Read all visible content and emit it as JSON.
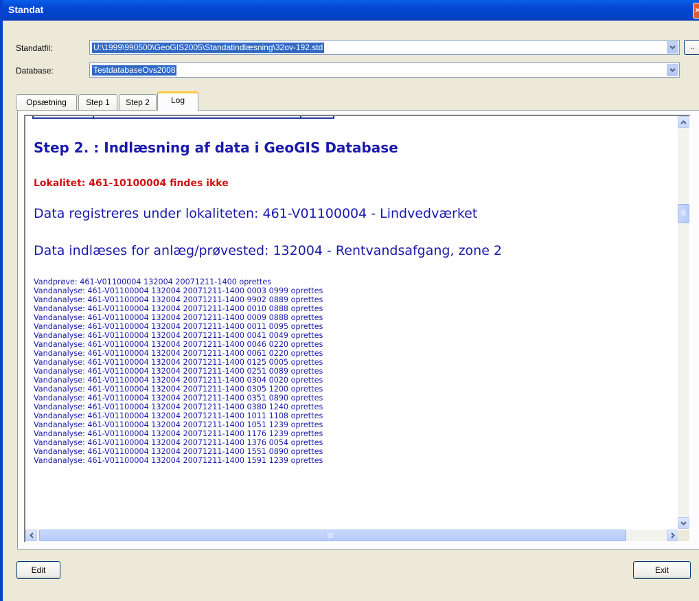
{
  "window": {
    "title": "Standat",
    "close_glyph": "✕"
  },
  "form": {
    "standatfil_label": "Standatfil:",
    "standatfil_value": "U:\\1999\\990500\\GeoGIS2005\\Standatindlæsning\\32ov-192.std",
    "browse_label": "..",
    "database_label": "Database:",
    "database_value": "TestdatabaseOvs2008"
  },
  "tabs": [
    {
      "label": "Opsætning",
      "active": false
    },
    {
      "label": "Step 1",
      "active": false
    },
    {
      "label": "Step 2",
      "active": false
    },
    {
      "label": "Log",
      "active": true
    }
  ],
  "log": {
    "heading": "Step 2. : Indlæsning af data i GeoGIS Database",
    "warning": "Lokalitet: 461-10100004 findes ikke",
    "locality_line": "Data registreres under lokaliteten: 461-V01100004 - Lindvedværket",
    "site_line": "Data indlæses for anlæg/prøvested: 132004 - Rentvandsafgang, zone 2",
    "entries": [
      "Vandprøve: 461-V01100004 132004 20071211-1400 oprettes",
      "Vandanalyse: 461-V01100004 132004 20071211-1400 0003 0999 oprettes",
      "Vandanalyse: 461-V01100004 132004 20071211-1400 9902 0889 oprettes",
      "Vandanalyse: 461-V01100004 132004 20071211-1400 0010 0888 oprettes",
      "Vandanalyse: 461-V01100004 132004 20071211-1400 0009 0888 oprettes",
      "Vandanalyse: 461-V01100004 132004 20071211-1400 0011 0095 oprettes",
      "Vandanalyse: 461-V01100004 132004 20071211-1400 0041 0049 oprettes",
      "Vandanalyse: 461-V01100004 132004 20071211-1400 0046 0220 oprettes",
      "Vandanalyse: 461-V01100004 132004 20071211-1400 0061 0220 oprettes",
      "Vandanalyse: 461-V01100004 132004 20071211-1400 0125 0005 oprettes",
      "Vandanalyse: 461-V01100004 132004 20071211-1400 0251 0089 oprettes",
      "Vandanalyse: 461-V01100004 132004 20071211-1400 0304 0020 oprettes",
      "Vandanalyse: 461-V01100004 132004 20071211-1400 0305 1200 oprettes",
      "Vandanalyse: 461-V01100004 132004 20071211-1400 0351 0890 oprettes",
      "Vandanalyse: 461-V01100004 132004 20071211-1400 0380 1240 oprettes",
      "Vandanalyse: 461-V01100004 132004 20071211-1400 1011 1108 oprettes",
      "Vandanalyse: 461-V01100004 132004 20071211-1400 1051 1239 oprettes",
      "Vandanalyse: 461-V01100004 132004 20071211-1400 1176 1239 oprettes",
      "Vandanalyse: 461-V01100004 132004 20071211-1400 1376 0054 oprettes",
      "Vandanalyse: 461-V01100004 132004 20071211-1400 1551 0890 oprettes",
      "Vandanalyse: 461-V01100004 132004 20071211-1400 1591 1239 oprettes"
    ]
  },
  "buttons": {
    "edit": "Edit",
    "exit": "Exit"
  },
  "colors": {
    "title_bar": "#0446d2",
    "log_text": "#1a1aab",
    "log_warning": "#d01010",
    "selection": "#316ac5",
    "active_tab_accent": "#ffc83c"
  },
  "icons": {
    "close": "close-icon",
    "dropdown": "chevron-down-icon",
    "scroll_up": "arrow-up-icon",
    "scroll_down": "arrow-down-icon",
    "scroll_left": "arrow-left-icon",
    "scroll_right": "arrow-right-icon",
    "grip": "grip-icon"
  }
}
